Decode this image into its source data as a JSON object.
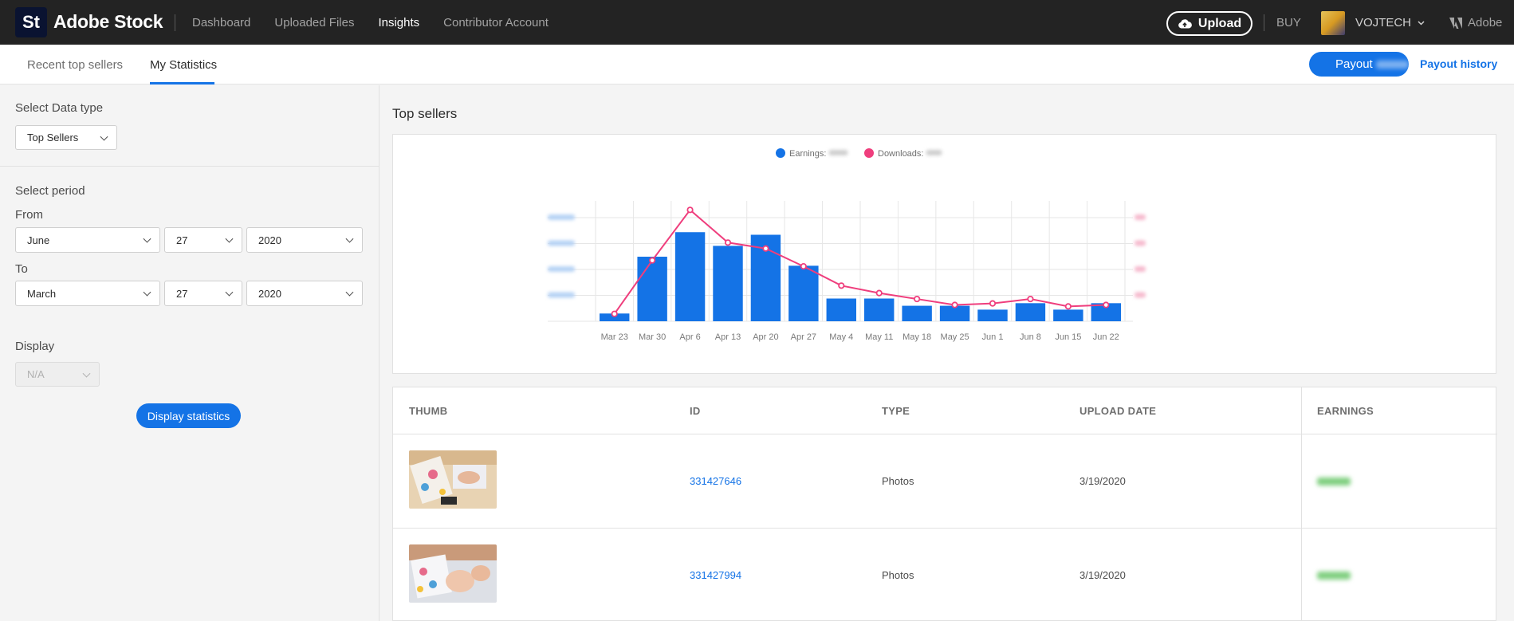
{
  "topbar": {
    "logo": "St",
    "brand": "Adobe Stock",
    "nav": [
      {
        "label": "Dashboard",
        "active": false
      },
      {
        "label": "Uploaded Files",
        "active": false
      },
      {
        "label": "Insights",
        "active": true
      },
      {
        "label": "Contributor Account",
        "active": false
      }
    ],
    "upload_label": "Upload",
    "buy_label": "BUY",
    "user_name": "VOJTECH",
    "adobe_label": "Adobe"
  },
  "tabs": {
    "items": [
      {
        "label": "Recent top sellers",
        "active": false
      },
      {
        "label": "My Statistics",
        "active": true
      }
    ],
    "payout_label": "Payout",
    "payout_history_label": "Payout history"
  },
  "sidebar": {
    "data_type_label": "Select Data type",
    "data_type_value": "Top Sellers",
    "period_label": "Select period",
    "from_label": "From",
    "from": {
      "month": "June",
      "day": "27",
      "year": "2020"
    },
    "to_label": "To",
    "to": {
      "month": "March",
      "day": "27",
      "year": "2020"
    },
    "display_label": "Display",
    "display_value": "N/A",
    "display_button": "Display statistics"
  },
  "main": {
    "title": "Top sellers",
    "table": {
      "headers": [
        "THUMB",
        "ID",
        "TYPE",
        "UPLOAD DATE",
        "EARNINGS"
      ],
      "rows": [
        {
          "id": "331427646",
          "type": "Photos",
          "date": "3/19/2020"
        },
        {
          "id": "331427994",
          "type": "Photos",
          "date": "3/19/2020"
        }
      ]
    }
  },
  "chart_data": {
    "type": "bar",
    "categories": [
      "Mar 23",
      "Mar 30",
      "Apr 6",
      "Apr 13",
      "Apr 20",
      "Apr 27",
      "May 4",
      "May 11",
      "May 18",
      "May 25",
      "Jun 1",
      "Jun 8",
      "Jun 15",
      "Jun 22"
    ],
    "series": [
      {
        "name": "Earnings:",
        "chart": "bar",
        "color": "#1473e6",
        "values": [
          30,
          250,
          345,
          292,
          335,
          215,
          88,
          88,
          60,
          60,
          45,
          70,
          45,
          70
        ]
      },
      {
        "name": "Downloads:",
        "chart": "line",
        "color": "#ef3e7d",
        "values": [
          5,
          41,
          75,
          53,
          49,
          37,
          24,
          19,
          15,
          11,
          12,
          15,
          10,
          11
        ]
      }
    ],
    "ylim": [
      0,
      460
    ],
    "y2lim": [
      0,
      80
    ],
    "grid": true,
    "legend": "top-center"
  }
}
